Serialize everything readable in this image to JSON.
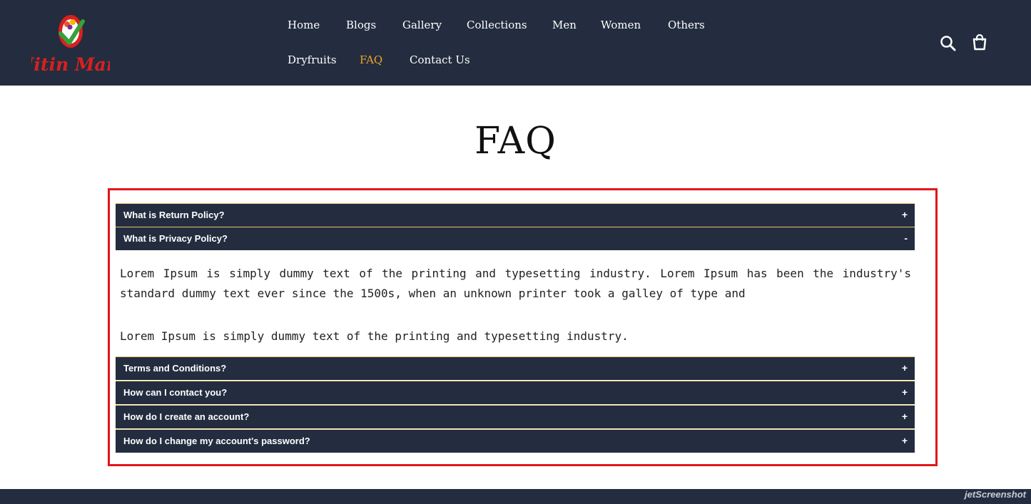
{
  "brand": {
    "name": "Nitin Mart",
    "accent_color": "#f3a22b",
    "header_bg": "#232d3f",
    "logo_red": "#d8201f",
    "logo_green": "#35a13a"
  },
  "nav": {
    "items": [
      {
        "label": "Home"
      },
      {
        "label": "Blogs"
      },
      {
        "label": "Gallery"
      },
      {
        "label": "Collections"
      },
      {
        "label": "Men"
      },
      {
        "label": "Women"
      },
      {
        "label": "Others"
      },
      {
        "label": "Dryfruits"
      },
      {
        "label": "FAQ",
        "active": true
      },
      {
        "label": "Contact Us"
      }
    ]
  },
  "header_icons": [
    "search-icon",
    "cart-icon"
  ],
  "page": {
    "title": "FAQ"
  },
  "faq": {
    "items": [
      {
        "question": "What is Return Policy?",
        "toggle": "+",
        "expanded": false
      },
      {
        "question": "What is Privacy Policy?",
        "toggle": "-",
        "expanded": true
      },
      {
        "question": "Terms and Conditions?",
        "toggle": "+",
        "expanded": false
      },
      {
        "question": "How can I contact you?",
        "toggle": "+",
        "expanded": false
      },
      {
        "question": "How do I create an account?",
        "toggle": "+",
        "expanded": false
      },
      {
        "question": "How do I change my account's password?",
        "toggle": "+",
        "expanded": false
      }
    ],
    "answer": {
      "paragraph1": "Lorem Ipsum is simply dummy text of the printing and typesetting industry. Lorem Ipsum has been the industry's standard dummy text ever since the 1500s, when an unknown printer took a galley of type and",
      "paragraph2": "Lorem Ipsum is simply dummy text of the printing and typesetting industry."
    },
    "highlight_color": "#e1171b"
  },
  "watermark": {
    "text": "jetScreenshot"
  }
}
